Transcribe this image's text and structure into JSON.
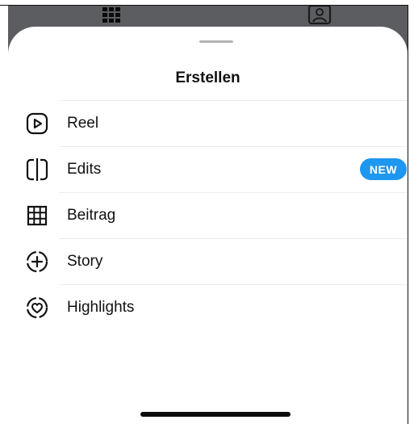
{
  "sheet": {
    "title": "Erstellen",
    "items": [
      {
        "label": "Reel",
        "icon": "reel-icon"
      },
      {
        "label": "Edits",
        "icon": "edits-icon",
        "badge": "NEW"
      },
      {
        "label": "Beitrag",
        "icon": "post-grid-icon"
      },
      {
        "label": "Story",
        "icon": "story-add-icon"
      },
      {
        "label": "Highlights",
        "icon": "highlight-heart-icon"
      }
    ]
  },
  "background": {
    "icons": [
      "grid-icon",
      "person-tag-icon"
    ]
  },
  "colors": {
    "badge": "#1e97f0",
    "backdrop": "#5b5d60",
    "sheet": "#ffffff"
  }
}
